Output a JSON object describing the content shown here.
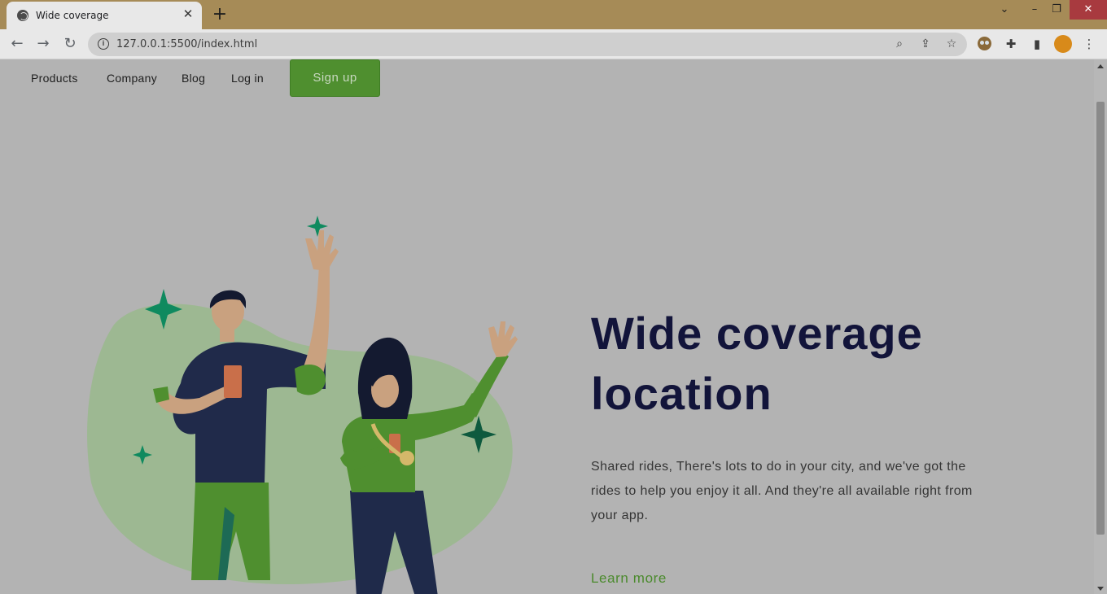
{
  "browser": {
    "tab_title": "Wide coverage",
    "new_tab": "+",
    "url": "127.0.0.1:5500/index.html"
  },
  "nav": {
    "items": [
      "Products",
      "Company",
      "Blog",
      "Log in"
    ],
    "signup_label": "Sign up"
  },
  "hero": {
    "title_line1": "Wide coverage",
    "title_line2": "location",
    "description": "Shared rides, There's lots to do in your city, and we've got the rides to help you enjoy it all. And they're all available right from your app.",
    "link_label": "Learn more"
  },
  "colors": {
    "accent_green": "#4f8f2f",
    "title_navy": "#12143a",
    "blob_green": "#9db892",
    "sparkle_teal": "#0f8a5f"
  },
  "icons": [
    "back-icon",
    "forward-icon",
    "reload-icon",
    "info-icon",
    "zoom-icon",
    "share-icon",
    "star-icon",
    "extension-icon",
    "puzzle-icon",
    "sidepanel-icon",
    "menu-icon"
  ]
}
